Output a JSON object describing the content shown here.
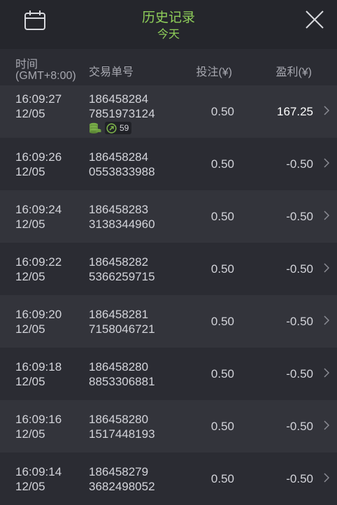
{
  "header": {
    "title": "历史记录",
    "subtitle": "今天",
    "calendar_icon": "calendar-icon",
    "close_icon": "close-icon",
    "title_color": "#8fcf5a"
  },
  "columns": {
    "time_line1": "时间",
    "time_line2": "(GMT+8:00)",
    "order": "交易单号",
    "bet": "投注(¥)",
    "profit": "盈利(¥)"
  },
  "rows": [
    {
      "time": "16:09:27",
      "date": "12/05",
      "order1": "186458284",
      "order2": "7851973124",
      "bet": "0.50",
      "profit": "167.25",
      "badge_count": "59"
    },
    {
      "time": "16:09:26",
      "date": "12/05",
      "order1": "186458284",
      "order2": "0553833988",
      "bet": "0.50",
      "profit": "-0.50"
    },
    {
      "time": "16:09:24",
      "date": "12/05",
      "order1": "186458283",
      "order2": "3138344960",
      "bet": "0.50",
      "profit": "-0.50"
    },
    {
      "time": "16:09:22",
      "date": "12/05",
      "order1": "186458282",
      "order2": "5366259715",
      "bet": "0.50",
      "profit": "-0.50"
    },
    {
      "time": "16:09:20",
      "date": "12/05",
      "order1": "186458281",
      "order2": "7158046721",
      "bet": "0.50",
      "profit": "-0.50"
    },
    {
      "time": "16:09:18",
      "date": "12/05",
      "order1": "186458280",
      "order2": "8853306881",
      "bet": "0.50",
      "profit": "-0.50"
    },
    {
      "time": "16:09:16",
      "date": "12/05",
      "order1": "186458280",
      "order2": "1517448193",
      "bet": "0.50",
      "profit": "-0.50"
    },
    {
      "time": "16:09:14",
      "date": "12/05",
      "order1": "186458279",
      "order2": "3682498052",
      "bet": "0.50",
      "profit": "-0.50"
    }
  ]
}
